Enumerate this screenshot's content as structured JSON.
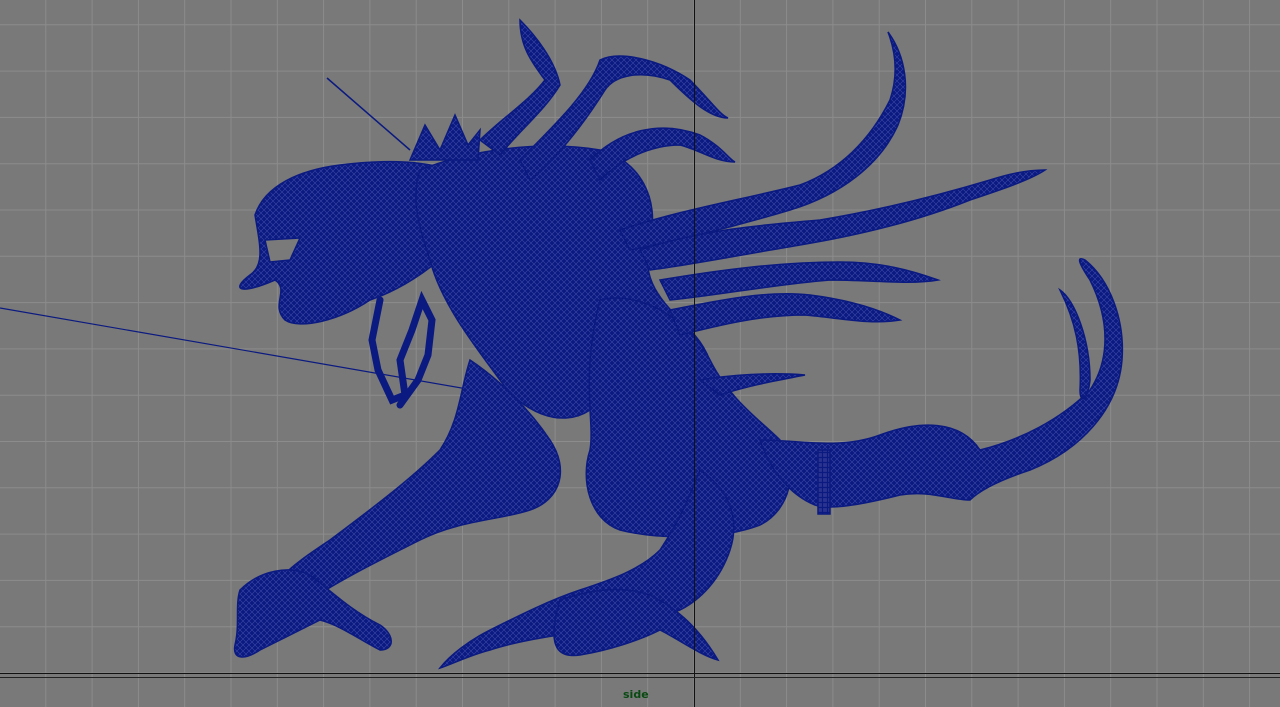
{
  "viewport": {
    "camera_label": "side",
    "background_color": "#797979",
    "grid_color": "#8c8c8c",
    "axis_color": "#111111",
    "wireframe_color": "#0b1a80",
    "label_color": "#0a4a12"
  }
}
